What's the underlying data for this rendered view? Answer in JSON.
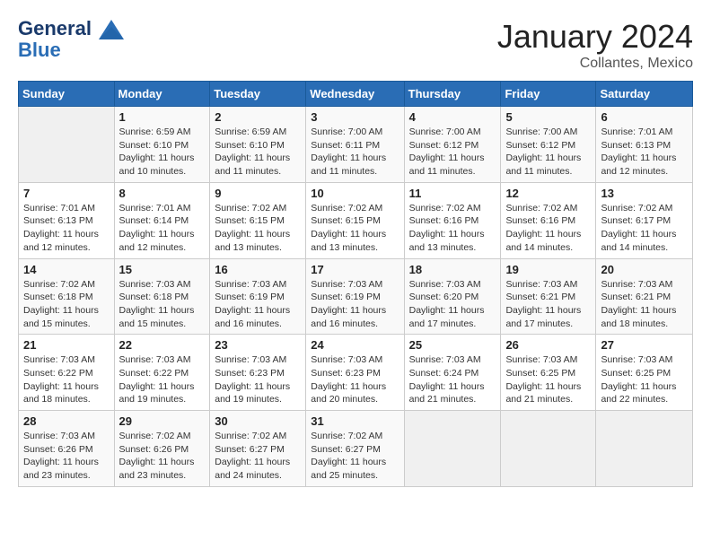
{
  "header": {
    "logo_line1": "General",
    "logo_line2": "Blue",
    "month": "January 2024",
    "location": "Collantes, Mexico"
  },
  "columns": [
    "Sunday",
    "Monday",
    "Tuesday",
    "Wednesday",
    "Thursday",
    "Friday",
    "Saturday"
  ],
  "weeks": [
    [
      {
        "day": "",
        "sunrise": "",
        "sunset": "",
        "daylight": ""
      },
      {
        "day": "1",
        "sunrise": "Sunrise: 6:59 AM",
        "sunset": "Sunset: 6:10 PM",
        "daylight": "Daylight: 11 hours and 10 minutes."
      },
      {
        "day": "2",
        "sunrise": "Sunrise: 6:59 AM",
        "sunset": "Sunset: 6:10 PM",
        "daylight": "Daylight: 11 hours and 11 minutes."
      },
      {
        "day": "3",
        "sunrise": "Sunrise: 7:00 AM",
        "sunset": "Sunset: 6:11 PM",
        "daylight": "Daylight: 11 hours and 11 minutes."
      },
      {
        "day": "4",
        "sunrise": "Sunrise: 7:00 AM",
        "sunset": "Sunset: 6:12 PM",
        "daylight": "Daylight: 11 hours and 11 minutes."
      },
      {
        "day": "5",
        "sunrise": "Sunrise: 7:00 AM",
        "sunset": "Sunset: 6:12 PM",
        "daylight": "Daylight: 11 hours and 11 minutes."
      },
      {
        "day": "6",
        "sunrise": "Sunrise: 7:01 AM",
        "sunset": "Sunset: 6:13 PM",
        "daylight": "Daylight: 11 hours and 12 minutes."
      }
    ],
    [
      {
        "day": "7",
        "sunrise": "Sunrise: 7:01 AM",
        "sunset": "Sunset: 6:13 PM",
        "daylight": "Daylight: 11 hours and 12 minutes."
      },
      {
        "day": "8",
        "sunrise": "Sunrise: 7:01 AM",
        "sunset": "Sunset: 6:14 PM",
        "daylight": "Daylight: 11 hours and 12 minutes."
      },
      {
        "day": "9",
        "sunrise": "Sunrise: 7:02 AM",
        "sunset": "Sunset: 6:15 PM",
        "daylight": "Daylight: 11 hours and 13 minutes."
      },
      {
        "day": "10",
        "sunrise": "Sunrise: 7:02 AM",
        "sunset": "Sunset: 6:15 PM",
        "daylight": "Daylight: 11 hours and 13 minutes."
      },
      {
        "day": "11",
        "sunrise": "Sunrise: 7:02 AM",
        "sunset": "Sunset: 6:16 PM",
        "daylight": "Daylight: 11 hours and 13 minutes."
      },
      {
        "day": "12",
        "sunrise": "Sunrise: 7:02 AM",
        "sunset": "Sunset: 6:16 PM",
        "daylight": "Daylight: 11 hours and 14 minutes."
      },
      {
        "day": "13",
        "sunrise": "Sunrise: 7:02 AM",
        "sunset": "Sunset: 6:17 PM",
        "daylight": "Daylight: 11 hours and 14 minutes."
      }
    ],
    [
      {
        "day": "14",
        "sunrise": "Sunrise: 7:02 AM",
        "sunset": "Sunset: 6:18 PM",
        "daylight": "Daylight: 11 hours and 15 minutes."
      },
      {
        "day": "15",
        "sunrise": "Sunrise: 7:03 AM",
        "sunset": "Sunset: 6:18 PM",
        "daylight": "Daylight: 11 hours and 15 minutes."
      },
      {
        "day": "16",
        "sunrise": "Sunrise: 7:03 AM",
        "sunset": "Sunset: 6:19 PM",
        "daylight": "Daylight: 11 hours and 16 minutes."
      },
      {
        "day": "17",
        "sunrise": "Sunrise: 7:03 AM",
        "sunset": "Sunset: 6:19 PM",
        "daylight": "Daylight: 11 hours and 16 minutes."
      },
      {
        "day": "18",
        "sunrise": "Sunrise: 7:03 AM",
        "sunset": "Sunset: 6:20 PM",
        "daylight": "Daylight: 11 hours and 17 minutes."
      },
      {
        "day": "19",
        "sunrise": "Sunrise: 7:03 AM",
        "sunset": "Sunset: 6:21 PM",
        "daylight": "Daylight: 11 hours and 17 minutes."
      },
      {
        "day": "20",
        "sunrise": "Sunrise: 7:03 AM",
        "sunset": "Sunset: 6:21 PM",
        "daylight": "Daylight: 11 hours and 18 minutes."
      }
    ],
    [
      {
        "day": "21",
        "sunrise": "Sunrise: 7:03 AM",
        "sunset": "Sunset: 6:22 PM",
        "daylight": "Daylight: 11 hours and 18 minutes."
      },
      {
        "day": "22",
        "sunrise": "Sunrise: 7:03 AM",
        "sunset": "Sunset: 6:22 PM",
        "daylight": "Daylight: 11 hours and 19 minutes."
      },
      {
        "day": "23",
        "sunrise": "Sunrise: 7:03 AM",
        "sunset": "Sunset: 6:23 PM",
        "daylight": "Daylight: 11 hours and 19 minutes."
      },
      {
        "day": "24",
        "sunrise": "Sunrise: 7:03 AM",
        "sunset": "Sunset: 6:23 PM",
        "daylight": "Daylight: 11 hours and 20 minutes."
      },
      {
        "day": "25",
        "sunrise": "Sunrise: 7:03 AM",
        "sunset": "Sunset: 6:24 PM",
        "daylight": "Daylight: 11 hours and 21 minutes."
      },
      {
        "day": "26",
        "sunrise": "Sunrise: 7:03 AM",
        "sunset": "Sunset: 6:25 PM",
        "daylight": "Daylight: 11 hours and 21 minutes."
      },
      {
        "day": "27",
        "sunrise": "Sunrise: 7:03 AM",
        "sunset": "Sunset: 6:25 PM",
        "daylight": "Daylight: 11 hours and 22 minutes."
      }
    ],
    [
      {
        "day": "28",
        "sunrise": "Sunrise: 7:03 AM",
        "sunset": "Sunset: 6:26 PM",
        "daylight": "Daylight: 11 hours and 23 minutes."
      },
      {
        "day": "29",
        "sunrise": "Sunrise: 7:02 AM",
        "sunset": "Sunset: 6:26 PM",
        "daylight": "Daylight: 11 hours and 23 minutes."
      },
      {
        "day": "30",
        "sunrise": "Sunrise: 7:02 AM",
        "sunset": "Sunset: 6:27 PM",
        "daylight": "Daylight: 11 hours and 24 minutes."
      },
      {
        "day": "31",
        "sunrise": "Sunrise: 7:02 AM",
        "sunset": "Sunset: 6:27 PM",
        "daylight": "Daylight: 11 hours and 25 minutes."
      },
      {
        "day": "",
        "sunrise": "",
        "sunset": "",
        "daylight": ""
      },
      {
        "day": "",
        "sunrise": "",
        "sunset": "",
        "daylight": ""
      },
      {
        "day": "",
        "sunrise": "",
        "sunset": "",
        "daylight": ""
      }
    ]
  ]
}
